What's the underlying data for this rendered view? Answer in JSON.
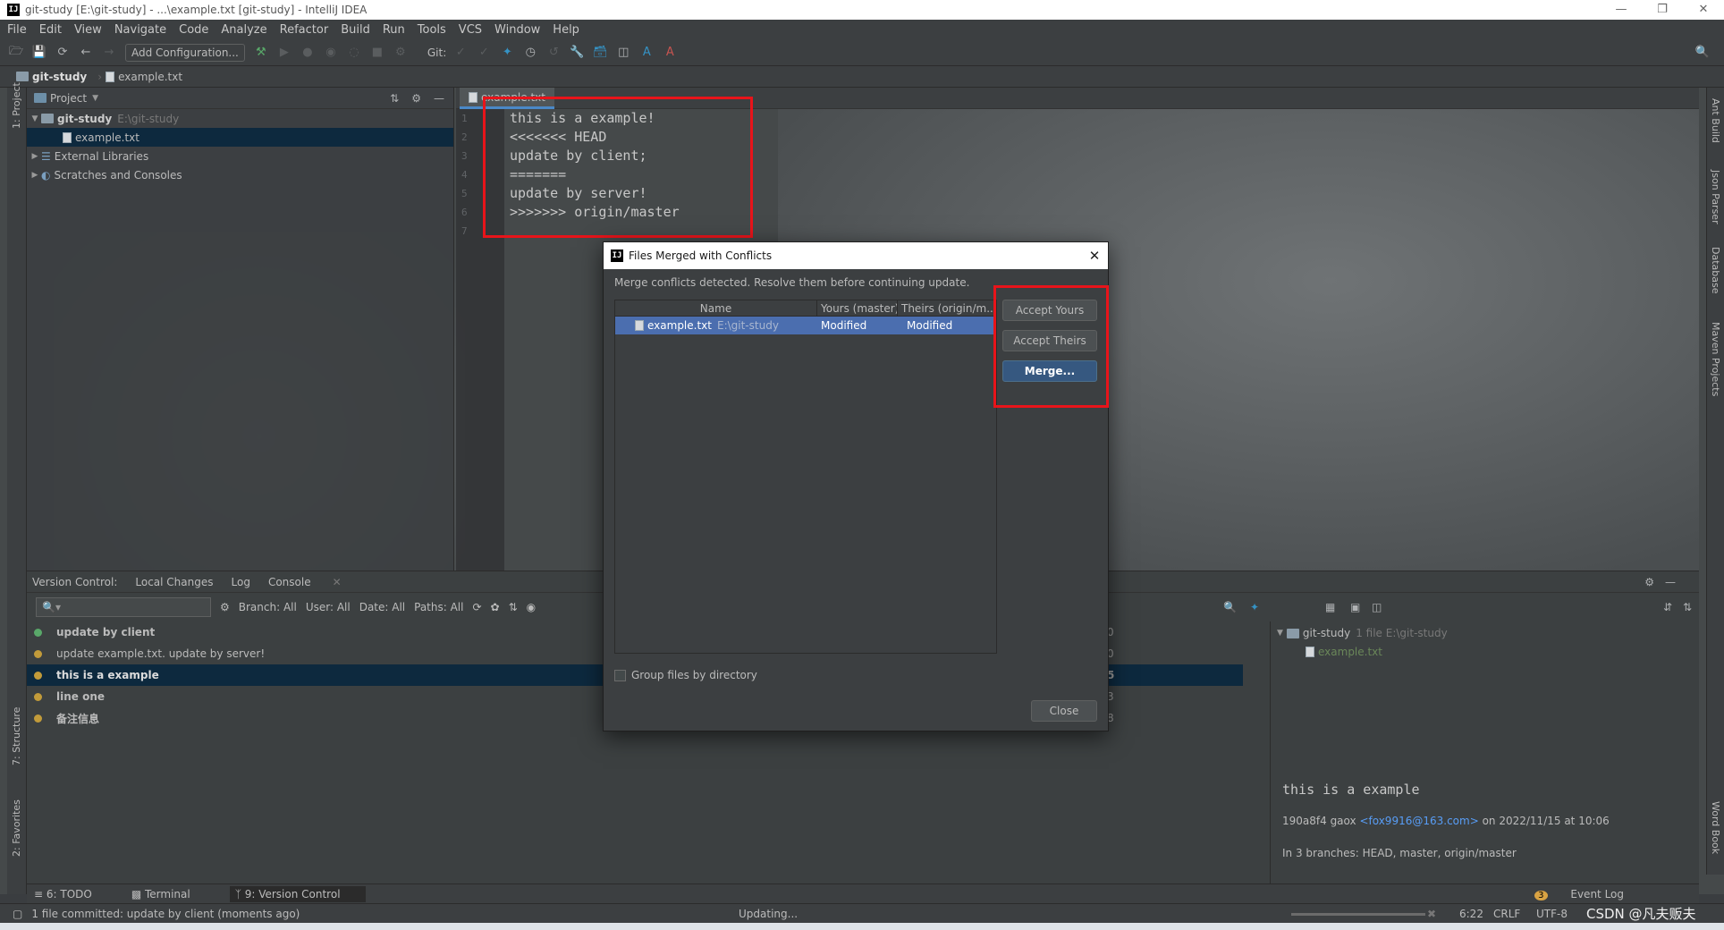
{
  "window": {
    "title": "git-study [E:\\git-study] - ...\\example.txt [git-study] - IntelliJ IDEA",
    "app_icon": "IJ"
  },
  "menu": [
    "File",
    "Edit",
    "View",
    "Navigate",
    "Code",
    "Analyze",
    "Refactor",
    "Build",
    "Run",
    "Tools",
    "VCS",
    "Window",
    "Help"
  ],
  "toolbar": {
    "add_config_label": "Add Configuration...",
    "git_label": "Git:"
  },
  "breadcrumb": {
    "project": "git-study",
    "file": "example.txt"
  },
  "left_strip": {
    "project_tab": "1: Project",
    "structure_tab": "7: Structure",
    "favorites_tab": "2: Favorites"
  },
  "right_strip": {
    "ant": "Ant Build",
    "json": "Json Parser",
    "database": "Database",
    "maven": "Maven Projects",
    "wordbook": "Word Book"
  },
  "project_panel": {
    "header": "Project",
    "tree": {
      "root_name": "git-study",
      "root_path": "E:\\git-study",
      "file": "example.txt",
      "ext_libs": "External Libraries",
      "scratches": "Scratches and Consoles"
    }
  },
  "editor": {
    "tab": "example.txt",
    "line_numbers": [
      "1",
      "2",
      "3",
      "4",
      "5",
      "6",
      "7"
    ],
    "lines": [
      "this is a example!",
      "<<<<<<< HEAD",
      "update by client;",
      "=======",
      "update by server!",
      ">>>>>>> origin/master",
      ""
    ]
  },
  "vc": {
    "tabs": {
      "vc": "Version Control:",
      "local": "Local Changes",
      "log": "Log",
      "console": "Console"
    },
    "filters": {
      "branch": "Branch: All",
      "user": "User: All",
      "date": "Date: All",
      "paths": "Paths: All"
    },
    "commits": [
      {
        "msg": "update by client",
        "hash_tail": "0"
      },
      {
        "msg": "update example.txt. update by server!",
        "hash_tail": "0"
      },
      {
        "msg": "this is a example",
        "hash_tail": "5"
      },
      {
        "msg": "line one",
        "hash_tail": "3"
      },
      {
        "msg": "备注信息",
        "hash_tail": "8"
      }
    ],
    "details": {
      "root": "git-study",
      "root_info": "1 file  E:\\git-study",
      "file": "example.txt",
      "message": "this is a example",
      "meta_prefix": "190a8f4 gaox",
      "email": "<fox9916@163.com>",
      "meta_suffix": "on 2022/11/15 at 10:06",
      "branches": "In 3 branches: HEAD, master, origin/master"
    }
  },
  "tool_tabs": {
    "todo": "6: TODO",
    "terminal": "Terminal",
    "vc": "9: Version Control",
    "event_log": "Event Log",
    "event_count": "3"
  },
  "status": {
    "message": "1 file committed: update by client (moments ago)",
    "updating": "Updating...",
    "position": "6:22",
    "line_sep": "CRLF",
    "encoding": "UTF-8",
    "watermark": "CSDN @凡夫贩夫"
  },
  "dialog": {
    "title": "Files Merged with Conflicts",
    "message": "Merge conflicts detected. Resolve them before continuing update.",
    "columns": [
      "Name",
      "Yours (master)",
      "Theirs (origin/m..."
    ],
    "row": {
      "name": "example.txt",
      "path": "E:\\git-study",
      "yours": "Modified",
      "theirs": "Modified"
    },
    "accept_yours": "Accept Yours",
    "accept_theirs": "Accept Theirs",
    "merge": "Merge...",
    "group_label": "Group files by directory",
    "close": "Close"
  }
}
